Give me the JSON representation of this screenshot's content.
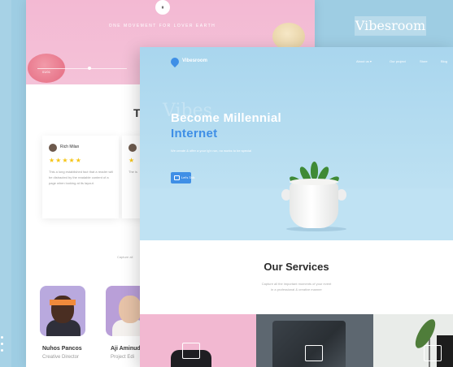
{
  "window": {
    "title": ""
  },
  "brand_badge": "Vibesroom",
  "back_page": {
    "tagline": "ONE MOVEMENT FOR LOVER EARTH",
    "play_glyph": "⏸",
    "hero_counter": "01/01",
    "section_title": "Te",
    "testimonials": [
      {
        "name": "Rich Milan",
        "stars": "★★★★★",
        "text": "This a long established fact that a reader will be distracted by the readable content of a page when looking at its layout."
      },
      {
        "name": "",
        "stars": "★",
        "text": "The is"
      }
    ],
    "caption": "Capture all",
    "team": [
      {
        "name": "Nuhos Pancos",
        "role": "Creative Director"
      },
      {
        "name": "Aji Aminud",
        "role": "Project Edi"
      }
    ]
  },
  "front_page": {
    "logo_text": "Vibesroom",
    "nav": [
      "About us ▾",
      "Our project",
      "Store",
      "Blog"
    ],
    "watermark": "Vibes",
    "hero_title_line1": "Become Millennial",
    "hero_title_line2": "Internet",
    "hero_subtitle": "We create & offer a your ig'n run, no works to be special",
    "cta_label": "Let's Talk",
    "services_title": "Our Services",
    "services_subtitle_line1": "Capture all the important moments of your event",
    "services_subtitle_line2": "in a professional & creative manner"
  },
  "colors": {
    "accent_blue": "#3f8fe6",
    "hero_sky": "#a9d6ee",
    "pink": "#f2b8d1",
    "star": "#f5c518",
    "background": "#9ecde3"
  },
  "icons": [
    "play-pause-icon",
    "logo-drop-icon",
    "chat-icon",
    "image-icon",
    "film-icon",
    "edit-icon",
    "star-icon"
  ]
}
